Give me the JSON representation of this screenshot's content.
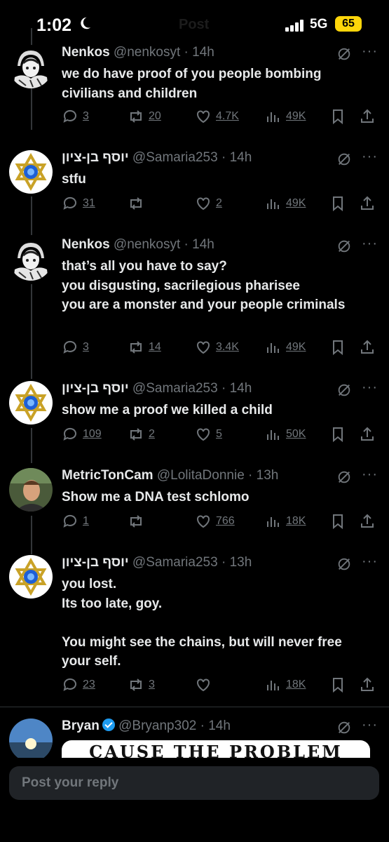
{
  "status": {
    "time": "1:02",
    "network": "5G",
    "battery": "65",
    "page_title": "Post"
  },
  "tweets": [
    {
      "name": "Nenkos",
      "handle": "@nenkosyt",
      "time": "14h",
      "text": "we do have proof of you people bombing civilians and children",
      "replies": "3",
      "reposts": "20",
      "likes": "4.7K",
      "views": "49K"
    },
    {
      "name": "יוסף בן-ציון",
      "handle": "@Samaria253",
      "time": "14h",
      "text": "stfu",
      "replies": "31",
      "reposts": "",
      "likes": "2",
      "views": "49K"
    },
    {
      "name": "Nenkos",
      "handle": "@nenkosyt",
      "time": "14h",
      "text": "that’s all you have to say?\nyou disgusting, sacrilegious pharisee\nyou are a monster and your people criminals",
      "replies": "3",
      "reposts": "14",
      "likes": "3.4K",
      "views": "49K"
    },
    {
      "name": "יוסף בן-ציון",
      "handle": "@Samaria253",
      "time": "14h",
      "text": "show me a proof we killed a child",
      "replies": "109",
      "reposts": "2",
      "likes": "5",
      "views": "50K"
    },
    {
      "name": "MetricTonCam",
      "handle": "@LolitaDonnie",
      "time": "13h",
      "text": "Show me a DNA test schlomo",
      "replies": "1",
      "reposts": "",
      "likes": "766",
      "views": "18K"
    },
    {
      "name": "יוסף בן-ציון",
      "handle": "@Samaria253",
      "time": "13h",
      "text": "you lost.\nIts too late, goy.\n\nYou might see the chains, but will never free your self.",
      "replies": "23",
      "reposts": "3",
      "likes": "",
      "views": "18K"
    },
    {
      "name": "Bryan",
      "handle": "@Bryanp302",
      "time": "14h",
      "verified": true,
      "media_text": "CAUSE THE PROBLEM"
    }
  ],
  "reply": {
    "placeholder": "Post your reply"
  },
  "colors": {
    "background": "#000000",
    "text": "#e7e9ea",
    "muted": "#71767b",
    "verified": "#1d9bf0",
    "battery": "#ffd60a"
  }
}
